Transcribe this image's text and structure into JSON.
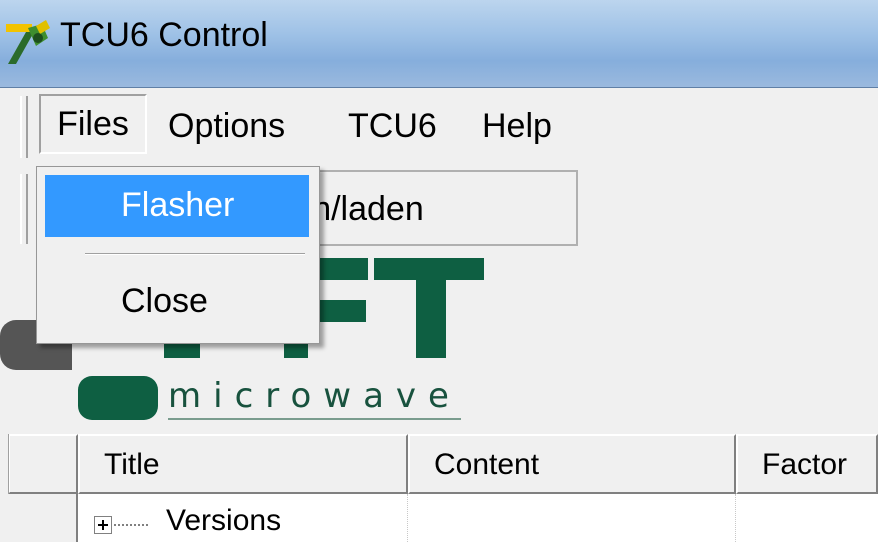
{
  "window": {
    "title": "TCU6 Control"
  },
  "menu": {
    "files": "Files",
    "options": "Options",
    "tcu6": "TCU6",
    "help": "Help"
  },
  "files_menu": {
    "items": [
      "Flasher",
      "Close"
    ]
  },
  "toolbar": {
    "save_load": "Speichern/laden"
  },
  "logo": {
    "tagline": "microwave"
  },
  "grid": {
    "columns": [
      "Title",
      "Content",
      "Factor"
    ],
    "rows": [
      {
        "title": "Versions"
      }
    ]
  },
  "colors": {
    "highlight": "#3399ff",
    "logo_green": "#0e5f42",
    "logo_gray": "#555555"
  },
  "icons": {
    "app": "tcu6-app-icon",
    "expand": "plus-expand-icon"
  }
}
